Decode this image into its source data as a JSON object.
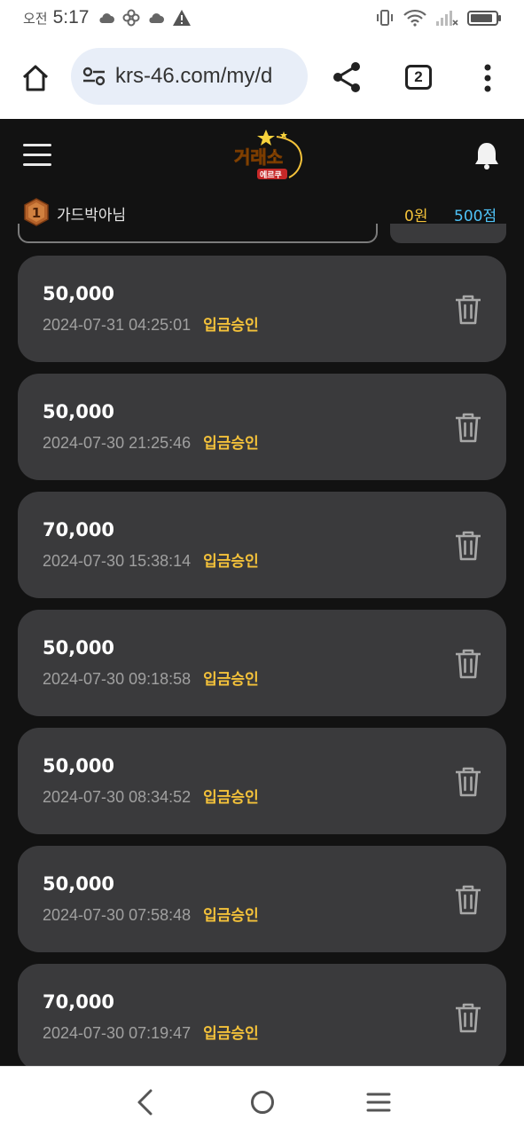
{
  "status_bar": {
    "ampm": "오전",
    "time": "5:17"
  },
  "browser": {
    "url": "krs-46.com/my/d",
    "tab_count": "2"
  },
  "header": {
    "logo_text": "거래소",
    "logo_sub": "에르쿠"
  },
  "user": {
    "rank": "1",
    "name": "가드박아님",
    "money": "0원",
    "points": "500점"
  },
  "transactions": [
    {
      "amount": "50,000",
      "date": "2024-07-31 04:25:01",
      "status": "입금승인"
    },
    {
      "amount": "50,000",
      "date": "2024-07-30 21:25:46",
      "status": "입금승인"
    },
    {
      "amount": "70,000",
      "date": "2024-07-30 15:38:14",
      "status": "입금승인"
    },
    {
      "amount": "50,000",
      "date": "2024-07-30 09:18:58",
      "status": "입금승인"
    },
    {
      "amount": "50,000",
      "date": "2024-07-30 08:34:52",
      "status": "입금승인"
    },
    {
      "amount": "50,000",
      "date": "2024-07-30 07:58:48",
      "status": "입금승인"
    },
    {
      "amount": "70,000",
      "date": "2024-07-30 07:19:47",
      "status": "입금승인"
    }
  ],
  "colors": {
    "app_bg": "#121212",
    "card_bg": "#3a3a3c",
    "status_yellow": "#f4c23a",
    "points_blue": "#4fc3f7"
  }
}
